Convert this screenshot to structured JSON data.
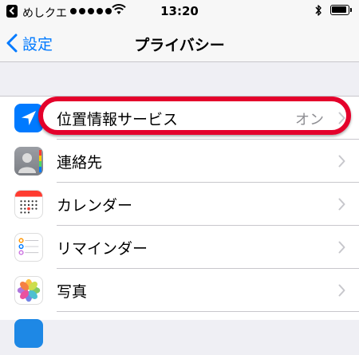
{
  "status_bar": {
    "carrier": "めしクエ",
    "time": "13:20"
  },
  "nav": {
    "back_label": "設定",
    "title": "プライバシー"
  },
  "rows": [
    {
      "label": "位置情報サービス",
      "value": "オン",
      "icon": "location-arrow-icon"
    },
    {
      "label": "連絡先",
      "value": "",
      "icon": "contacts-icon"
    },
    {
      "label": "カレンダー",
      "value": "",
      "icon": "calendar-icon"
    },
    {
      "label": "リマインダー",
      "value": "",
      "icon": "reminders-icon"
    },
    {
      "label": "写真",
      "value": "",
      "icon": "photos-icon"
    }
  ],
  "colors": {
    "accent": "#007aff",
    "highlight": "#e4002b",
    "secondary_text": "#8e8e93",
    "background": "#efeff4"
  }
}
